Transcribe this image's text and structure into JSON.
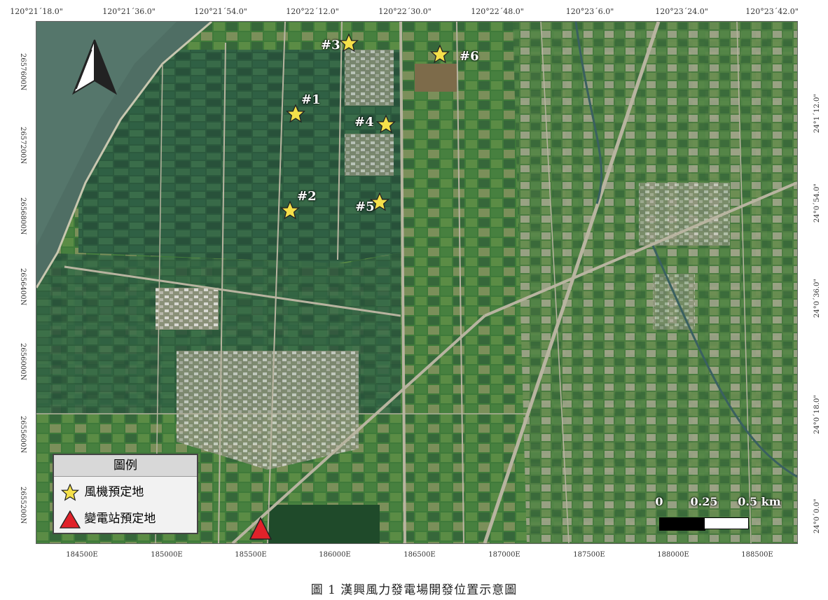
{
  "top_ticks": [
    "120°21´18.0\"",
    "120°21´36.0\"",
    "120°21´54.0\"",
    "120°22´12.0\"",
    "120°22´30.0\"",
    "120°22´48.0\"",
    "120°23´6.0\"",
    "120°23´24.0\"",
    "120°23´42.0\""
  ],
  "bottom_ticks": [
    "184500E",
    "185000E",
    "185500E",
    "186000E",
    "186500E",
    "187000E",
    "187500E",
    "188000E",
    "188500E"
  ],
  "left_ticks": [
    "2657600N",
    "2657200N",
    "2656800N",
    "2656400N",
    "2656000N",
    "2655600N",
    "2655200N"
  ],
  "right_ticks": [
    "24°1´12.0\"",
    "24°0´54.0\"",
    "24°0´36.0\"",
    "24°0´18.0\"",
    "24°0´0.0\""
  ],
  "turbines": [
    {
      "label": "#1"
    },
    {
      "label": "#2"
    },
    {
      "label": "#3"
    },
    {
      "label": "#4"
    },
    {
      "label": "#5"
    },
    {
      "label": "#6"
    }
  ],
  "legend": {
    "title": "圖例",
    "turbine_label": "風機預定地",
    "substation_label": "變電站預定地"
  },
  "scale_bar": {
    "zero": "0",
    "mid": "0.25",
    "end": "0.5 km"
  },
  "caption": "圖 1 漢興風力發電場開發位置示意圖",
  "colors": {
    "star": "#f5e04a",
    "substation": "#e0222a",
    "water": "#4f6e64",
    "field": "#2f6a3a"
  }
}
